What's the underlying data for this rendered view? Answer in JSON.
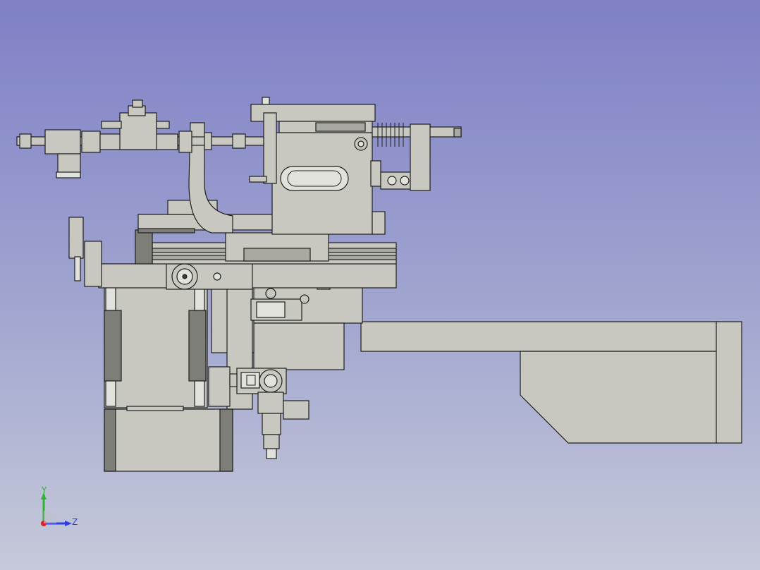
{
  "viewport": {
    "background_top": "#7f80c6",
    "background_bottom": "#c6c9d9"
  },
  "model": {
    "part_color": "#c8c8c0",
    "edge_color": "#1e1e1e"
  },
  "axis_triad": {
    "y_label": "Y",
    "z_label": "Z",
    "y_color": "#2fb52f",
    "z_color": "#2f3fe0",
    "x_color": "#e02020"
  }
}
